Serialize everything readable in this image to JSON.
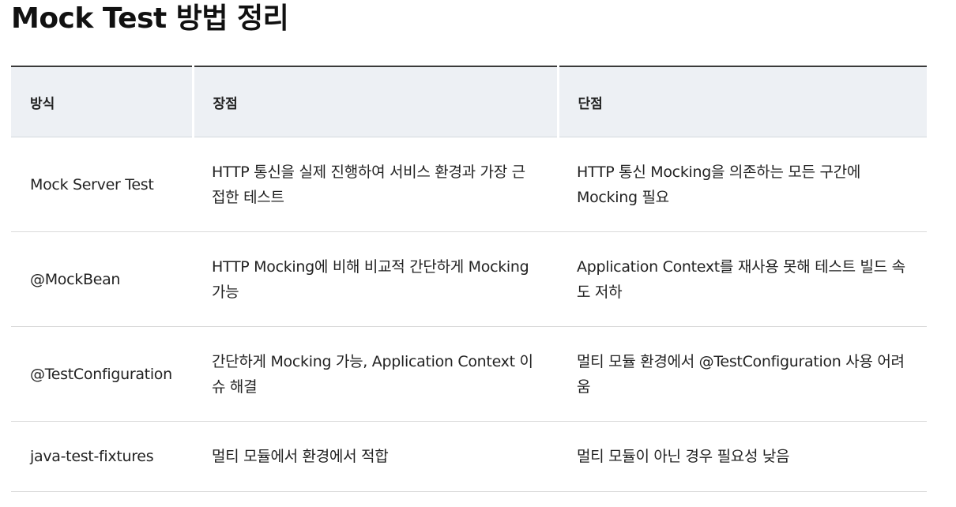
{
  "page": {
    "title": "Mock Test 방법 정리"
  },
  "table": {
    "headers": [
      "방식",
      "장점",
      "단점"
    ],
    "rows": [
      {
        "method": "Mock Server Test",
        "pros": "HTTP 통신을 실제 진행하여 서비스 환경과 가장 근접한 테스트",
        "cons": "HTTP 통신 Mocking을 의존하는 모든 구간에 Mocking 필요"
      },
      {
        "method": "@MockBean",
        "pros": "HTTP Mocking에 비해 비교적 간단하게 Mocking 가능",
        "cons": "Application Context를 재사용 못해 테스트 빌드 속도 저하"
      },
      {
        "method": "@TestConfiguration",
        "pros": "간단하게 Mocking 가능, Application Context 이슈 해결",
        "cons": "멀티 모듈 환경에서 @TestConfiguration 사용 어려움"
      },
      {
        "method": "java-test-fixtures",
        "pros": "멀티 모듈에서 환경에서 적합",
        "cons": "멀티 모듈이 아닌 경우 필요성 낮음"
      }
    ]
  }
}
